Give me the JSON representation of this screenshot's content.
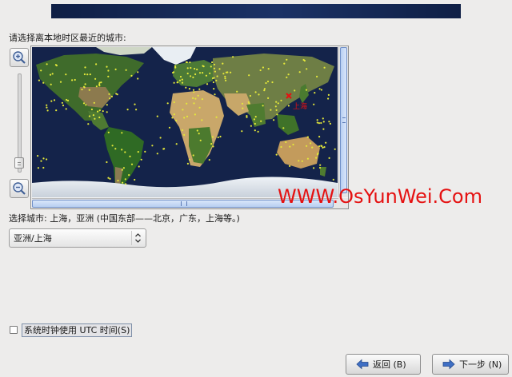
{
  "header": {
    "banner_color": "#1b3266"
  },
  "timezone": {
    "prompt": "请选择离本地时区最近的城市:",
    "zoom_in_icon": "zoom-in-icon",
    "zoom_out_icon": "zoom-out-icon",
    "zoom_level": 0.95,
    "map": {
      "selected_city_label": "上海",
      "marker_color": "#e51111",
      "city_dot_color": "#e4e83a"
    },
    "selected_city_text": "选择城市: 上海，亚洲 (中国东部——北京，广东，上海等。)",
    "select": {
      "value": "亚洲/上海"
    }
  },
  "watermark": {
    "text": "WWW.OsYunWei.Com",
    "color": "#e51111"
  },
  "options": {
    "utc_label": "系统时钟使用 UTC 时间(S)",
    "utc_checked": false
  },
  "buttons": {
    "back": "返回 (B)",
    "next": "下一步 (N)"
  }
}
